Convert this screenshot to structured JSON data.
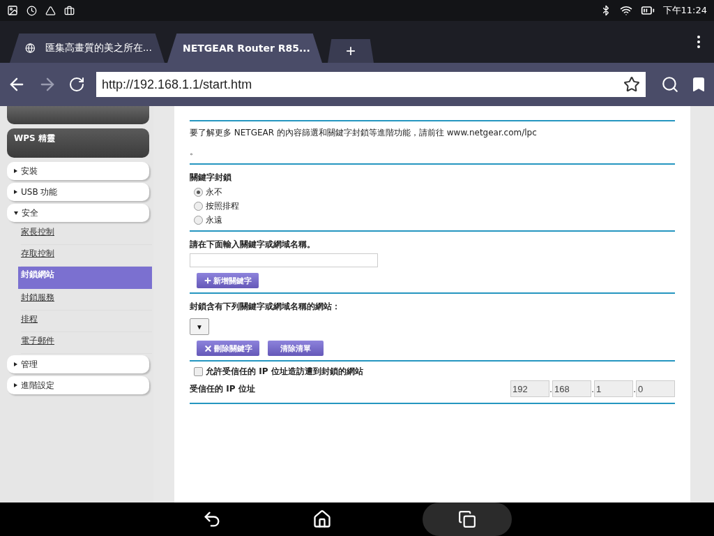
{
  "status_bar": {
    "time": "下午11:24"
  },
  "tabs": [
    {
      "title": "匯集高畫質的美之所在...",
      "selected": false
    },
    {
      "title": "NETGEAR Router R85...",
      "selected": true
    }
  ],
  "new_tab": "+",
  "address_bar": {
    "url": "http://192.168.1.1/start.htm"
  },
  "sidebar": {
    "items": [
      {
        "kind": "wizard",
        "label": "WPS 精靈"
      },
      {
        "kind": "section",
        "label": "安裝",
        "expanded": false
      },
      {
        "kind": "section",
        "label": "USB 功能",
        "expanded": false
      },
      {
        "kind": "section",
        "label": "安全",
        "expanded": true,
        "children": [
          {
            "label": "家長控制",
            "selected": false
          },
          {
            "label": "存取控制",
            "selected": false
          },
          {
            "label": "封鎖網站",
            "selected": true
          },
          {
            "label": "封鎖服務",
            "selected": false
          },
          {
            "label": "排程",
            "selected": false
          },
          {
            "label": "電子郵件",
            "selected": false
          }
        ]
      },
      {
        "kind": "section",
        "label": "管理",
        "expanded": false
      },
      {
        "kind": "section",
        "label": "進階設定",
        "expanded": false
      }
    ]
  },
  "info": {
    "text": "要了解更多 NETGEAR 的內容篩選和關鍵字封鎖等進階功能，請前往 www.netgear.com/lpc",
    "period": "。"
  },
  "keyword_blocking": {
    "title": "關鍵字封鎖",
    "options": [
      {
        "label": "永不",
        "selected": true
      },
      {
        "label": "按照排程",
        "selected": false
      },
      {
        "label": "永遠",
        "selected": false
      }
    ]
  },
  "keyword_entry": {
    "label": "請在下面輸入關鍵字或網域名稱。",
    "add_button": "新增關鍵字"
  },
  "blocked_list": {
    "label": "封鎖含有下列關鍵字或網域名稱的網站：",
    "dropdown_arrow": "▼",
    "delete_button": "刪除關鍵字",
    "clear_button": "清除清單"
  },
  "trusted": {
    "checkbox": {
      "label": "允許受信任的 IP 位址造訪遭到封鎖的網站",
      "checked": false
    },
    "ip_label": "受信任的 IP 位址",
    "separator": ".",
    "ip_octets": [
      "192",
      "168",
      "1",
      "0"
    ]
  }
}
